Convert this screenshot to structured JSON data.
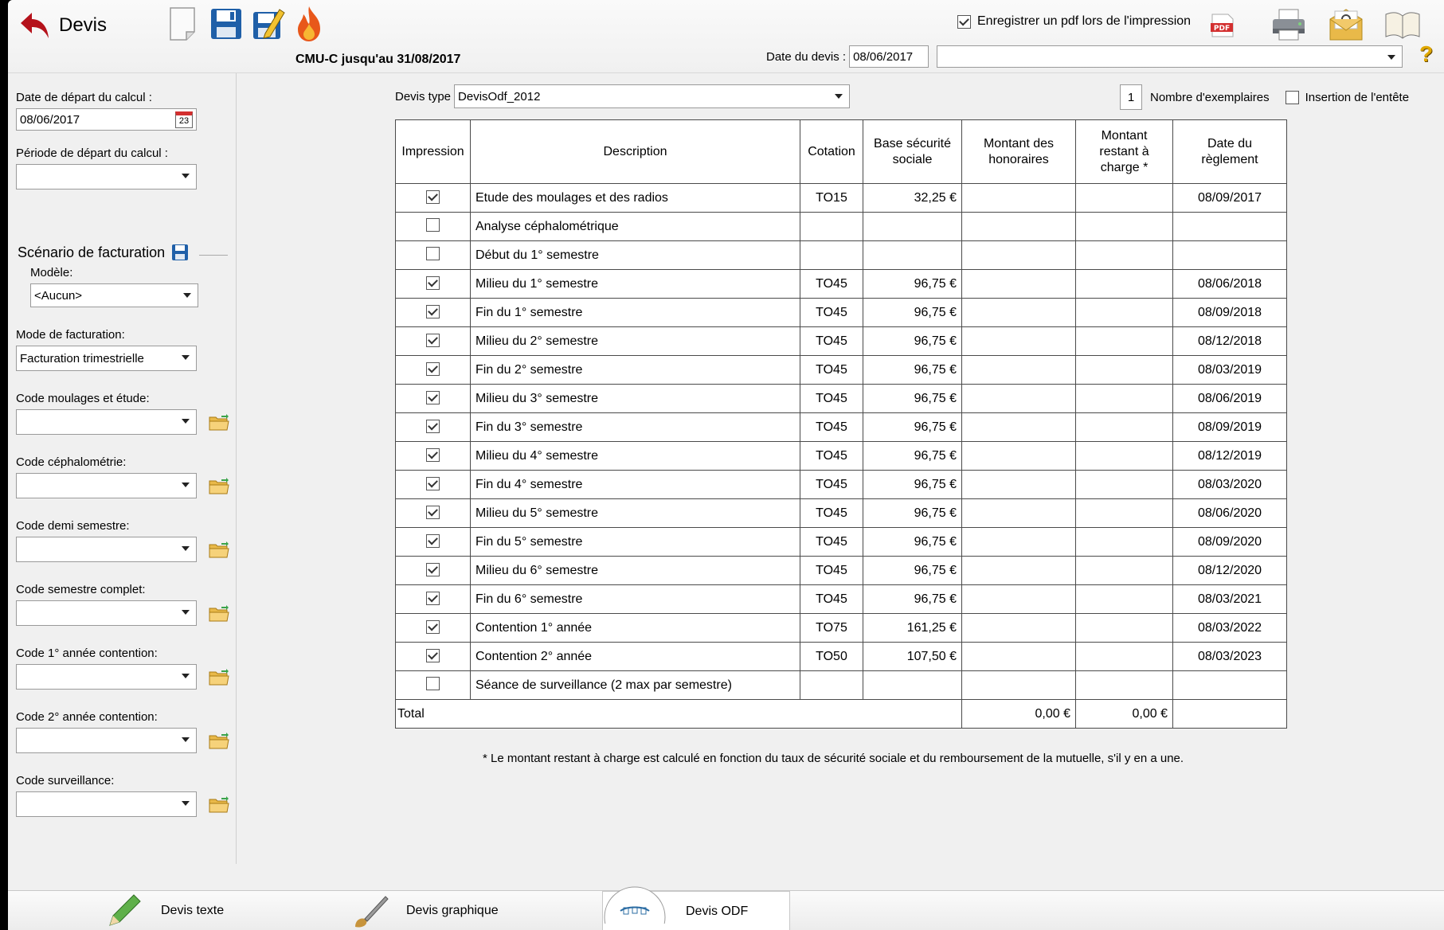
{
  "toolbar": {
    "back_label": "Devis",
    "cmu_text": "CMU-C jusqu'au 31/08/2017",
    "pdf_checkbox_label": "Enregistrer un pdf lors de l'impression",
    "pdf_icon_text": "PDF",
    "date_devis_label": "Date du devis :",
    "date_devis_value": "08/06/2017",
    "help_glyph": "?",
    "icons": [
      "new-document-icon",
      "save-icon",
      "save-edit-icon",
      "fire-icon",
      "pdf-icon",
      "printer-icon",
      "email-icon",
      "book-icon",
      "help-icon"
    ]
  },
  "left_panel": {
    "date_depart_label": "Date de départ du calcul :",
    "date_depart_value": "08/06/2017",
    "calendar_day": "23",
    "periode_label": "Période de départ du calcul :",
    "scenario_title": "Scénario de facturation",
    "modele_label": "Modèle:",
    "modele_value": "<Aucun>",
    "mode_label": "Mode de facturation:",
    "mode_value": "Facturation trimestrielle",
    "codes": [
      {
        "label": "Code moulages et étude:"
      },
      {
        "label": "Code céphalométrie:"
      },
      {
        "label": "Code demi semestre:"
      },
      {
        "label": "Code semestre complet:"
      },
      {
        "label": "Code 1° année contention:"
      },
      {
        "label": "Code 2° année contention:"
      },
      {
        "label": "Code surveillance:"
      }
    ]
  },
  "main": {
    "devis_type_label": "Devis type",
    "devis_type_value": "DevisOdf_2012",
    "exemplaires_value": "1",
    "exemplaires_label": "Nombre d'exemplaires",
    "insertion_label": "Insertion de l'entête",
    "headers": {
      "impression": "Impression",
      "description": "Description",
      "cotation": "Cotation",
      "base": "Base sécurité sociale",
      "honoraires": "Montant des honoraires",
      "restant": "Montant restant à charge *",
      "date": "Date du règlement"
    },
    "rows": [
      {
        "checked": true,
        "description": "Etude des moulages et des radios",
        "cotation": "TO15",
        "base": "32,25 €",
        "honoraires": "",
        "restant": "",
        "date": "08/09/2017"
      },
      {
        "checked": false,
        "description": "Analyse céphalométrique",
        "cotation": "",
        "base": "",
        "honoraires": "",
        "restant": "",
        "date": ""
      },
      {
        "checked": false,
        "description": "Début du 1° semestre",
        "cotation": "",
        "base": "",
        "honoraires": "",
        "restant": "",
        "date": ""
      },
      {
        "checked": true,
        "description": "Milieu du 1° semestre",
        "cotation": "TO45",
        "base": "96,75 €",
        "honoraires": "",
        "restant": "",
        "date": "08/06/2018"
      },
      {
        "checked": true,
        "description": "Fin du 1° semestre",
        "cotation": "TO45",
        "base": "96,75 €",
        "honoraires": "",
        "restant": "",
        "date": "08/09/2018"
      },
      {
        "checked": true,
        "description": "Milieu du 2° semestre",
        "cotation": "TO45",
        "base": "96,75 €",
        "honoraires": "",
        "restant": "",
        "date": "08/12/2018"
      },
      {
        "checked": true,
        "description": "Fin du 2° semestre",
        "cotation": "TO45",
        "base": "96,75 €",
        "honoraires": "",
        "restant": "",
        "date": "08/03/2019"
      },
      {
        "checked": true,
        "description": "Milieu du 3° semestre",
        "cotation": "TO45",
        "base": "96,75 €",
        "honoraires": "",
        "restant": "",
        "date": "08/06/2019"
      },
      {
        "checked": true,
        "description": "Fin du 3° semestre",
        "cotation": "TO45",
        "base": "96,75 €",
        "honoraires": "",
        "restant": "",
        "date": "08/09/2019"
      },
      {
        "checked": true,
        "description": "Milieu du 4° semestre",
        "cotation": "TO45",
        "base": "96,75 €",
        "honoraires": "",
        "restant": "",
        "date": "08/12/2019"
      },
      {
        "checked": true,
        "description": "Fin du 4° semestre",
        "cotation": "TO45",
        "base": "96,75 €",
        "honoraires": "",
        "restant": "",
        "date": "08/03/2020"
      },
      {
        "checked": true,
        "description": "Milieu du 5° semestre",
        "cotation": "TO45",
        "base": "96,75 €",
        "honoraires": "",
        "restant": "",
        "date": "08/06/2020"
      },
      {
        "checked": true,
        "description": "Fin du 5° semestre",
        "cotation": "TO45",
        "base": "96,75 €",
        "honoraires": "",
        "restant": "",
        "date": "08/09/2020"
      },
      {
        "checked": true,
        "description": "Milieu du 6° semestre",
        "cotation": "TO45",
        "base": "96,75 €",
        "honoraires": "",
        "restant": "",
        "date": "08/12/2020"
      },
      {
        "checked": true,
        "description": "Fin du 6° semestre",
        "cotation": "TO45",
        "base": "96,75 €",
        "honoraires": "",
        "restant": "",
        "date": "08/03/2021"
      },
      {
        "checked": true,
        "description": "Contention 1° année",
        "cotation": "TO75",
        "base": "161,25 €",
        "honoraires": "",
        "restant": "",
        "date": "08/03/2022"
      },
      {
        "checked": true,
        "description": "Contention 2° année",
        "cotation": "TO50",
        "base": "107,50 €",
        "honoraires": "",
        "restant": "",
        "date": "08/03/2023"
      },
      {
        "checked": false,
        "description": "Séance de surveillance (2 max par semestre)",
        "cotation": "",
        "base": "",
        "honoraires": "",
        "restant": "",
        "date": ""
      }
    ],
    "total_label": "Total",
    "total_honoraires": "0,00 €",
    "total_restant": "0,00 €",
    "footnote": "* Le montant restant à charge est calculé en fonction du taux de sécurité sociale et du remboursement de la mutuelle, s'il y en a une."
  },
  "bottom_tabs": [
    {
      "label": "Devis texte",
      "icon": "pencil-icon"
    },
    {
      "label": "Devis graphique",
      "icon": "brush-icon"
    },
    {
      "label": "Devis ODF",
      "icon": "braces-icon",
      "active": true
    }
  ],
  "colors": {
    "back_arrow": "#b5121b",
    "save_blue": "#1f5fa8",
    "fire": "#e8571a",
    "pdf_red": "#d32f2f",
    "folder": "#e9b949"
  }
}
